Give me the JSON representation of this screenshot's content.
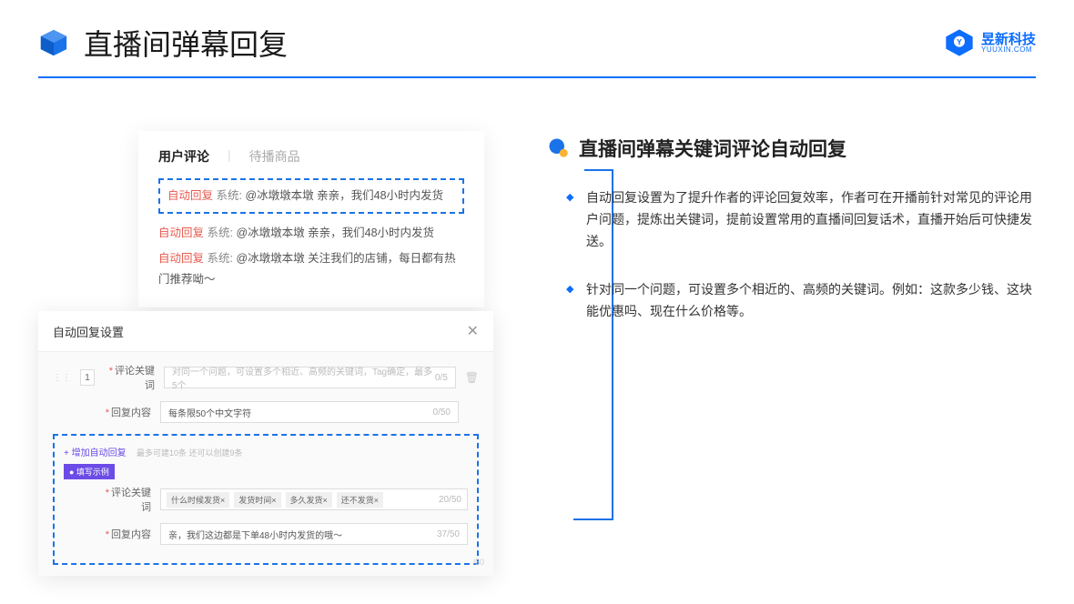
{
  "header": {
    "title": "直播间弹幕回复",
    "brand_name": "昱新科技",
    "brand_sub": "YUUXIN.COM"
  },
  "comment_panel": {
    "tab_active": "用户评论",
    "tab_inactive": "待播商品",
    "rows": [
      {
        "badge": "自动回复",
        "sys": "系统:",
        "text": "@冰墩墩本墩 亲亲，我们48小时内发货"
      },
      {
        "badge": "自动回复",
        "sys": "系统:",
        "text": "@冰墩墩本墩 亲亲，我们48小时内发货"
      },
      {
        "badge": "自动回复",
        "sys": "系统:",
        "text": "@冰墩墩本墩 关注我们的店铺，每日都有热门推荐呦～"
      }
    ]
  },
  "settings": {
    "title": "自动回复设置",
    "num": "1",
    "label_keyword": "评论关键词",
    "placeholder_keyword": "对同一个问题，可设置多个相近、高频的关键词，Tag确定，最多5个",
    "counter_keyword": "0/5",
    "label_content": "回复内容",
    "placeholder_content": "每条限50个中文字符",
    "counter_content": "0/50",
    "add_link": "+ 增加自动回复",
    "add_hint": "最多可建10条 还可以创建9条",
    "example_badge": "● 填写示例",
    "eg_label_keyword": "评论关键词",
    "eg_tags": [
      "什么时候发货×",
      "发货时间×",
      "多久发货×",
      "还不发货×"
    ],
    "eg_counter_keyword": "20/50",
    "eg_label_content": "回复内容",
    "eg_content": "亲，我们这边都是下单48小时内发货的哦～",
    "eg_counter_content": "37/50",
    "outer_counter": "/50"
  },
  "right": {
    "section_title": "直播间弹幕关键词评论自动回复",
    "bullets": [
      "自动回复设置为了提升作者的评论回复效率，作者可在开播前针对常见的评论用户问题，提炼出关键词，提前设置常用的直播间回复话术，直播开始后可快捷发送。",
      "针对同一个问题，可设置多个相近的、高频的关键词。例如：这款多少钱、这块能优惠吗、现在什么价格等。"
    ]
  }
}
